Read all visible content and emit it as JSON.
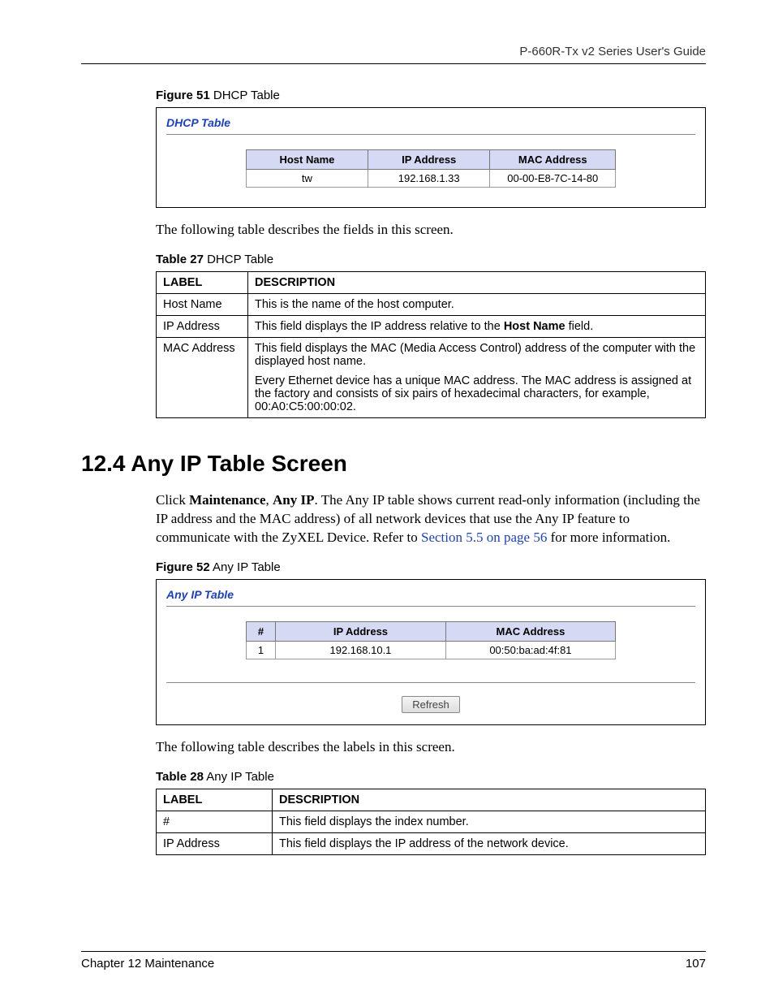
{
  "doc_title": "P-660R-Tx v2 Series User's Guide",
  "figure51": {
    "caption_bold": "Figure 51",
    "caption": "   DHCP Table",
    "screen_title": "DHCP Table",
    "headers": [
      "Host Name",
      "IP Address",
      "MAC Address"
    ],
    "row": [
      "tw",
      "192.168.1.33",
      "00-00-E8-7C-14-80"
    ]
  },
  "para_after_fig51": "The following table describes the fields in this screen.",
  "table27": {
    "caption_bold": "Table 27",
    "caption": "   DHCP Table",
    "header_label": "LABEL",
    "header_desc": "DESCRIPTION",
    "rows": [
      {
        "label": "Host Name",
        "desc": "This is the name of the host computer."
      },
      {
        "label": "IP Address",
        "desc_pre": "This field displays the IP address relative to the ",
        "desc_bold": "Host Name",
        "desc_post": " field."
      },
      {
        "label": "MAC Address",
        "p1": "This field displays the MAC (Media Access Control) address of the computer with the displayed host name.",
        "p2": "Every Ethernet device has a unique MAC address. The MAC address is assigned at the factory and consists of six pairs of hexadecimal characters, for example, 00:A0:C5:00:00:02."
      }
    ]
  },
  "section_head": "12.4  Any IP Table Screen",
  "para_anyip_pre": "Click ",
  "para_anyip_b1": "Maintenance",
  "para_anyip_comma": ", ",
  "para_anyip_b2": "Any IP",
  "para_anyip_mid": ". The Any IP table shows current read-only information (including the IP address and the MAC address) of all network devices that use the Any IP feature to communicate with the ZyXEL Device. Refer to ",
  "para_anyip_link": "Section 5.5 on page 56",
  "para_anyip_post": " for more information.",
  "figure52": {
    "caption_bold": "Figure 52",
    "caption": "   Any IP Table",
    "screen_title": "Any IP Table",
    "headers": [
      "#",
      "IP Address",
      "MAC Address"
    ],
    "row": [
      "1",
      "192.168.10.1",
      "00:50:ba:ad:4f:81"
    ],
    "button": "Refresh"
  },
  "para_after_fig52": "The following table describes the labels in this screen.",
  "table28": {
    "caption_bold": "Table 28",
    "caption": "   Any IP Table",
    "header_label": "LABEL",
    "header_desc": "DESCRIPTION",
    "rows": [
      {
        "label": "#",
        "desc": "This field displays the index number."
      },
      {
        "label": "IP Address",
        "desc": "This field displays the IP address of the network device."
      }
    ]
  },
  "footer_left": "Chapter 12 Maintenance",
  "footer_right": "107"
}
